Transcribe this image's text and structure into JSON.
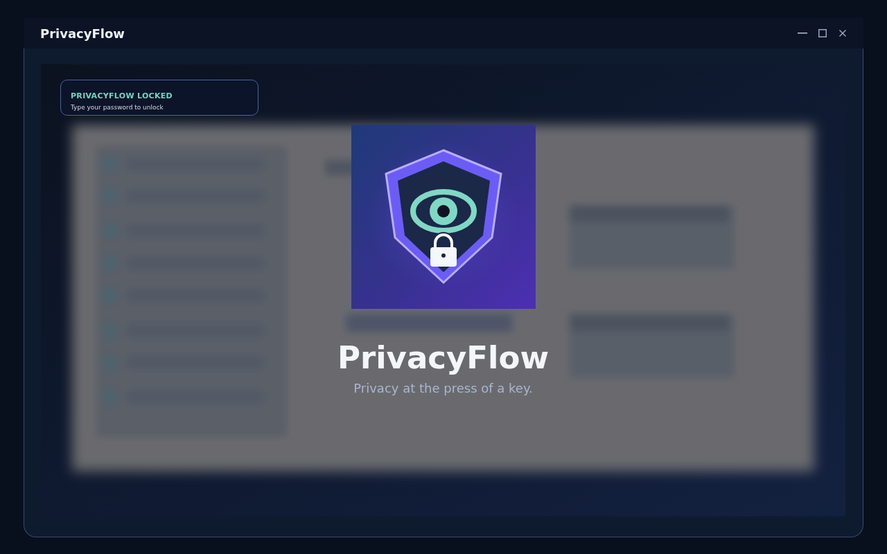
{
  "window": {
    "title": "PrivacyFlow"
  },
  "lock_notice": {
    "title": "PRIVACYFLOW LOCKED",
    "message": "Type your password to unlock"
  },
  "splash": {
    "title": "PrivacyFlow",
    "tagline": "Privacy at the press of a key."
  }
}
